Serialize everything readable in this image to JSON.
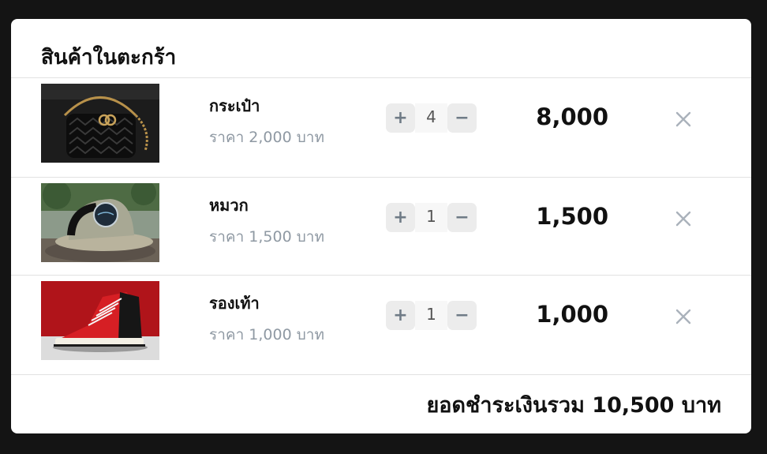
{
  "cart": {
    "title": "สินค้าในตะกร้า",
    "items": [
      {
        "name": "กระเป๋า",
        "price_label": "ราคา 2,000 บาท",
        "quantity": "4",
        "line_total": "8,000",
        "image_icon": "bag-photo"
      },
      {
        "name": "หมวก",
        "price_label": "ราคา 1,500 บาท",
        "quantity": "1",
        "line_total": "1,500",
        "image_icon": "cap-photo"
      },
      {
        "name": "รองเท้า",
        "price_label": "ราคา 1,000 บาท",
        "quantity": "1",
        "line_total": "1,000",
        "image_icon": "sneaker-photo"
      }
    ],
    "controls": {
      "plus": "+",
      "minus": "−"
    },
    "summary": {
      "label": "ยอดชำระเงินรวม",
      "amount": "10,500",
      "currency": "บาท"
    }
  },
  "colors": {
    "background": "#141414",
    "card": "#ffffff",
    "muted_text": "#8f99a3",
    "stepper_button": "#ececec",
    "remove_icon": "#aab2bb"
  }
}
